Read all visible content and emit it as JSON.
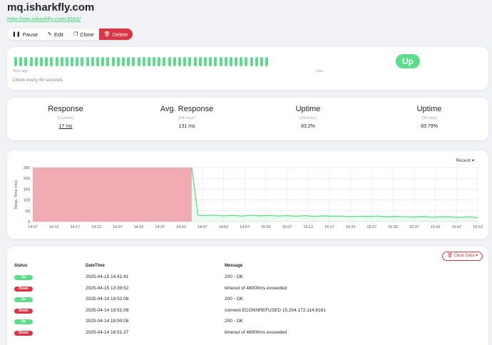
{
  "page": {
    "title": "mq.isharkfly.com",
    "url": "http://mq.isharkfly.com:8161/"
  },
  "toolbar": {
    "pause": "Pause",
    "edit": "Edit",
    "clone": "Clone",
    "delete": "Delete"
  },
  "heartbeat": {
    "bar_count": 50,
    "start_label": "56m ago",
    "end_label": "now",
    "check_text": "Check every 60 seconds",
    "status": "Up",
    "color": "#5cdd8b"
  },
  "stats": [
    {
      "title": "Response",
      "sub": "(Current)",
      "value": "17 ms"
    },
    {
      "title": "Avg. Response",
      "sub": "(24-hour)",
      "value": "131 ms"
    },
    {
      "title": "Uptime",
      "sub": "(24-hour)",
      "value": "83.2%"
    },
    {
      "title": "Uptime",
      "sub": "(30-day)",
      "value": "83.79%"
    }
  ],
  "chart_selector": "Recent",
  "chart_data": {
    "type": "line",
    "ylabel": "Resp. Time (ms)",
    "ylim": [
      0,
      250
    ],
    "yticks": [
      0,
      50,
      100,
      150,
      200,
      250
    ],
    "xticks": [
      "14:07",
      "14:12",
      "14:17",
      "14:22",
      "14:27",
      "14:32",
      "14:37",
      "14:42",
      "14:47",
      "14:52",
      "14:57",
      "15:02",
      "15:07",
      "15:12",
      "15:17",
      "15:22",
      "15:27",
      "15:32",
      "15:37",
      "15:42",
      "15:47",
      "15:52"
    ],
    "xmin_minutes": 0,
    "xmax_minutes": 49,
    "down_region": [
      0,
      17.5
    ],
    "series": [
      {
        "values": [
          [
            17.5,
            250
          ],
          [
            18.2,
            30
          ],
          [
            19,
            28
          ],
          [
            20,
            30
          ],
          [
            21,
            27
          ],
          [
            22,
            29
          ],
          [
            23,
            26
          ],
          [
            24,
            30
          ],
          [
            25,
            27
          ],
          [
            26,
            29
          ],
          [
            27,
            26
          ],
          [
            28,
            28
          ],
          [
            29,
            25
          ],
          [
            30,
            28
          ],
          [
            31,
            24
          ],
          [
            32,
            27
          ],
          [
            33,
            25
          ],
          [
            34,
            26
          ],
          [
            35,
            23
          ],
          [
            36,
            25
          ],
          [
            37,
            24
          ],
          [
            38,
            26
          ],
          [
            39,
            22
          ],
          [
            40,
            24
          ],
          [
            41,
            23
          ],
          [
            42,
            22
          ],
          [
            43,
            24
          ],
          [
            44,
            21
          ],
          [
            45,
            23
          ],
          [
            46,
            22
          ],
          [
            47,
            20
          ],
          [
            48,
            23
          ],
          [
            49,
            18
          ]
        ],
        "color": "#5cdd8b"
      }
    ],
    "down_color": "#f0a3ab"
  },
  "events": {
    "clear_label": "Clear Data",
    "headers": {
      "status": "Status",
      "datetime": "DateTime",
      "message": "Message"
    },
    "rows": [
      {
        "status": "Up",
        "datetime": "2025-04-15 14:41:41",
        "message": "200 - OK"
      },
      {
        "status": "Down",
        "datetime": "2025-04-15 13:39:52",
        "message": "timeout of 48000ms exceeded"
      },
      {
        "status": "Up",
        "datetime": "2025-04-14 19:52:08",
        "message": "200 - OK"
      },
      {
        "status": "Down",
        "datetime": "2025-04-14 19:51:08",
        "message": "connect ECONNREFUSED 15.204.172.114:8161"
      },
      {
        "status": "Up",
        "datetime": "2025-04-14 19:50:08",
        "message": "200 - OK"
      },
      {
        "status": "Down",
        "datetime": "2025-04-14 16:51:27",
        "message": "timeout of 48000ms exceeded"
      }
    ]
  }
}
